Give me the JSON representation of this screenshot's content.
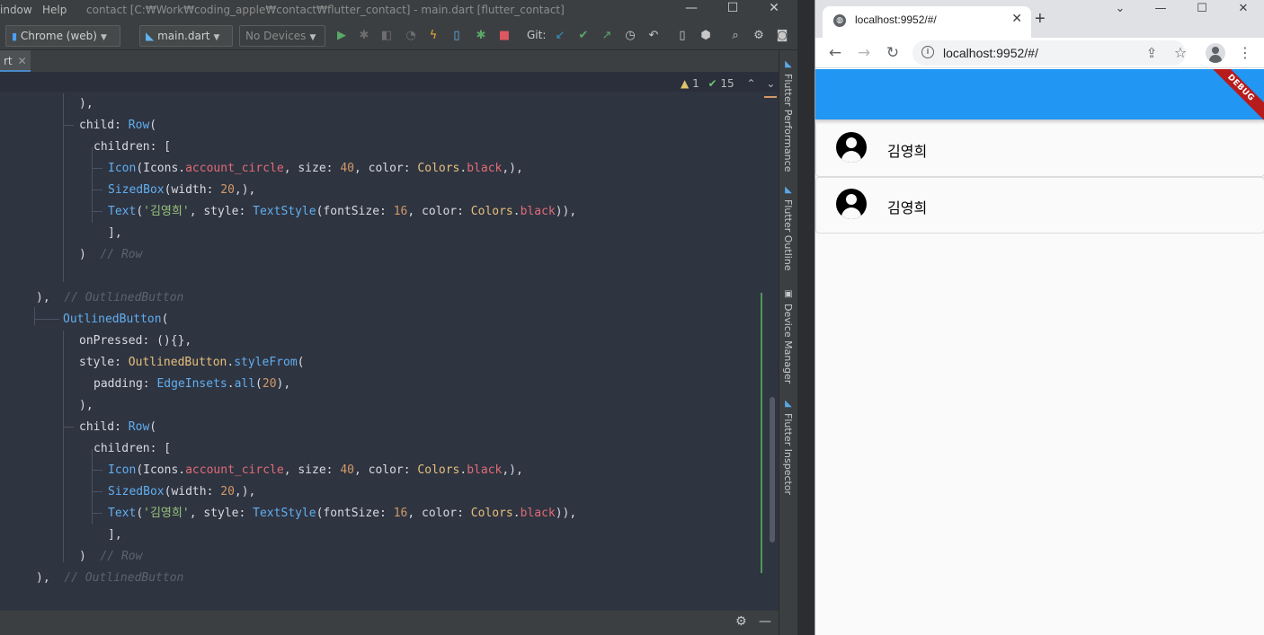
{
  "ide": {
    "menu": [
      "indow",
      "Help"
    ],
    "window_title": "contact [C:₩Work₩coding_apple₩contact₩flutter_contact] - main.dart [flutter_contact]",
    "window_controls": {
      "minimize": "—",
      "maximize": "☐",
      "close": "✕"
    },
    "toolbar": {
      "device_target": "Chrome (web)",
      "run_config": "main.dart",
      "devices": "No Devices",
      "git_label": "Git:"
    },
    "editor_tab": {
      "label": "rt",
      "close": "✕"
    },
    "inspections": {
      "warnings": "1",
      "checks": "15"
    },
    "side_tabs": [
      "Flutter Performance",
      "Flutter Outline",
      "Device Manager",
      "Flutter Inspector"
    ],
    "code_lines": [
      [
        {
          "t": "),",
          "k": "plain"
        }
      ],
      [
        {
          "t": "child: ",
          "k": "plain"
        },
        {
          "t": "Row",
          "k": "cls"
        },
        {
          "t": "(",
          "k": "plain"
        }
      ],
      [
        {
          "t": "children: [",
          "k": "plain"
        }
      ],
      [
        {
          "t": "Icon",
          "k": "cls"
        },
        {
          "t": "(",
          "k": "plain"
        },
        {
          "t": "Icons",
          "k": "plain"
        },
        {
          "t": ".",
          "k": "plain"
        },
        {
          "t": "account_circle",
          "k": "fld"
        },
        {
          "t": ", size: ",
          "k": "plain"
        },
        {
          "t": "40",
          "k": "num"
        },
        {
          "t": ", color: ",
          "k": "plain"
        },
        {
          "t": "Colors",
          "k": "fn"
        },
        {
          "t": ".",
          "k": "plain"
        },
        {
          "t": "black",
          "k": "fld"
        },
        {
          "t": ",),",
          "k": "plain"
        }
      ],
      [
        {
          "t": "SizedBox",
          "k": "cls"
        },
        {
          "t": "(width: ",
          "k": "plain"
        },
        {
          "t": "20",
          "k": "num"
        },
        {
          "t": ",),",
          "k": "plain"
        }
      ],
      [
        {
          "t": "Text",
          "k": "cls"
        },
        {
          "t": "(",
          "k": "plain"
        },
        {
          "t": "'김영희'",
          "k": "str"
        },
        {
          "t": ", style: ",
          "k": "plain"
        },
        {
          "t": "TextStyle",
          "k": "cls"
        },
        {
          "t": "(fontSize: ",
          "k": "plain"
        },
        {
          "t": "16",
          "k": "num"
        },
        {
          "t": ", color: ",
          "k": "plain"
        },
        {
          "t": "Colors",
          "k": "fn"
        },
        {
          "t": ".",
          "k": "plain"
        },
        {
          "t": "black",
          "k": "fld"
        },
        {
          "t": ")),",
          "k": "plain"
        }
      ],
      [
        {
          "t": "],",
          "k": "plain"
        }
      ],
      [
        {
          "t": ")  ",
          "k": "plain"
        },
        {
          "t": "// Row",
          "k": "cmt"
        }
      ],
      [],
      [
        {
          "t": "),  ",
          "k": "plain"
        },
        {
          "t": "// OutlinedButton",
          "k": "cmt"
        }
      ],
      [
        {
          "t": "OutlinedButton",
          "k": "cls"
        },
        {
          "t": "(",
          "k": "plain"
        }
      ],
      [
        {
          "t": "onPressed: (){},",
          "k": "plain"
        }
      ],
      [
        {
          "t": "style: ",
          "k": "plain"
        },
        {
          "t": "OutlinedButton",
          "k": "fn"
        },
        {
          "t": ".",
          "k": "plain"
        },
        {
          "t": "styleFrom",
          "k": "cls"
        },
        {
          "t": "(",
          "k": "plain"
        }
      ],
      [
        {
          "t": "padding: ",
          "k": "plain"
        },
        {
          "t": "EdgeInsets",
          "k": "cls"
        },
        {
          "t": ".",
          "k": "plain"
        },
        {
          "t": "all",
          "k": "cls"
        },
        {
          "t": "(",
          "k": "plain"
        },
        {
          "t": "20",
          "k": "num"
        },
        {
          "t": "),",
          "k": "plain"
        }
      ],
      [
        {
          "t": "),",
          "k": "plain"
        }
      ],
      [
        {
          "t": "child: ",
          "k": "plain"
        },
        {
          "t": "Row",
          "k": "cls"
        },
        {
          "t": "(",
          "k": "plain"
        }
      ],
      [
        {
          "t": "children: [",
          "k": "plain"
        }
      ],
      [
        {
          "t": "Icon",
          "k": "cls"
        },
        {
          "t": "(",
          "k": "plain"
        },
        {
          "t": "Icons",
          "k": "plain"
        },
        {
          "t": ".",
          "k": "plain"
        },
        {
          "t": "account_circle",
          "k": "fld"
        },
        {
          "t": ", size: ",
          "k": "plain"
        },
        {
          "t": "40",
          "k": "num"
        },
        {
          "t": ", color: ",
          "k": "plain"
        },
        {
          "t": "Colors",
          "k": "fn"
        },
        {
          "t": ".",
          "k": "plain"
        },
        {
          "t": "black",
          "k": "fld"
        },
        {
          "t": ",),",
          "k": "plain"
        }
      ],
      [
        {
          "t": "SizedBox",
          "k": "cls"
        },
        {
          "t": "(width: ",
          "k": "plain"
        },
        {
          "t": "20",
          "k": "num"
        },
        {
          "t": ",),",
          "k": "plain"
        }
      ],
      [
        {
          "t": "Text",
          "k": "cls"
        },
        {
          "t": "(",
          "k": "plain"
        },
        {
          "t": "'김영희'",
          "k": "str"
        },
        {
          "t": ", style: ",
          "k": "plain"
        },
        {
          "t": "TextStyle",
          "k": "cls"
        },
        {
          "t": "(fontSize: ",
          "k": "plain"
        },
        {
          "t": "16",
          "k": "num"
        },
        {
          "t": ", color: ",
          "k": "plain"
        },
        {
          "t": "Colors",
          "k": "fn"
        },
        {
          "t": ".",
          "k": "plain"
        },
        {
          "t": "black",
          "k": "fld"
        },
        {
          "t": ")),",
          "k": "plain"
        }
      ],
      [
        {
          "t": "],",
          "k": "plain"
        }
      ],
      [
        {
          "t": ")  ",
          "k": "plain"
        },
        {
          "t": "// Row",
          "k": "cmt"
        }
      ],
      [
        {
          "t": "),  ",
          "k": "plain"
        },
        {
          "t": "// OutlinedButton",
          "k": "cmt"
        }
      ]
    ]
  },
  "browser": {
    "tab_title": "localhost:9952/#/",
    "tab_close": "✕",
    "new_tab": "+",
    "url": "localhost:9952/#/",
    "debug_banner": "DEBUG",
    "contacts": [
      {
        "name": "김영희"
      },
      {
        "name": "김영희"
      }
    ],
    "colors": {
      "appbar": "#2196f3",
      "debug_banner": "#b71c1c"
    }
  }
}
